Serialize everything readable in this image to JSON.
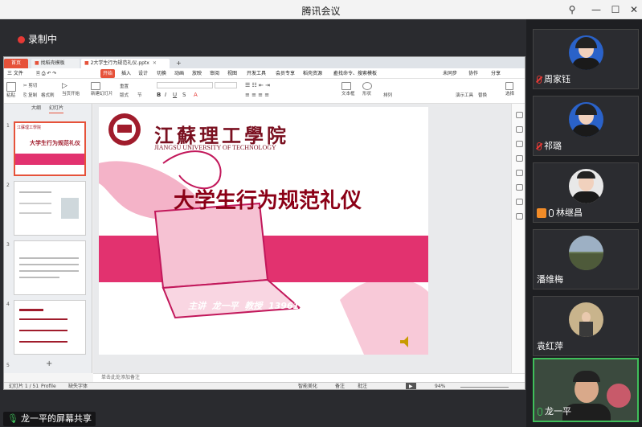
{
  "window": {
    "title": "腾讯会议"
  },
  "recording": {
    "label": "录制中"
  },
  "share_status": "龙一平的屏幕共享",
  "wps": {
    "tabs": [
      {
        "label": "首页"
      },
      {
        "label": "找稻壳模板"
      },
      {
        "label": "2大学生行为规范礼仪.pptx"
      }
    ],
    "menu": [
      "三 文件",
      "开始",
      "插入",
      "设计",
      "切换",
      "动画",
      "放映",
      "审阅",
      "视图",
      "开发工具",
      "会员专享",
      "稻壳资源"
    ],
    "menu_search": "查找命令、搜索模板",
    "menu_right": [
      "未同步",
      "协作",
      "分享"
    ],
    "toolbar_left": [
      "粘贴",
      "剪切",
      "复制",
      "格式刷",
      "当页开始",
      "新建幻灯片",
      "版式",
      "节",
      "重置"
    ],
    "toolbar_right": [
      "文本框",
      "形状",
      "排列",
      "演示工具",
      "替换",
      "选择"
    ],
    "left_tabs": [
      "大纲",
      "幻灯片"
    ],
    "slide_count": [
      "1",
      "2",
      "3",
      "4",
      "5"
    ],
    "notes_placeholder": "单击此处添加备注",
    "status": {
      "page": "幻灯片 1 / 51",
      "profile": "Profile",
      "font_missing": "缺失字体",
      "beautify": "智能美化",
      "notes": "备注",
      "comment": "批注",
      "zoom": "94%"
    },
    "slide": {
      "school_cn": "江蘇理工學院",
      "school_en": "JIANGSU UNIVERSITY OF TECHNOLOGY",
      "title": "大学生行为规范礼仪",
      "presenter": "主讲  龙一平  教授  13961122308"
    }
  },
  "participants": [
    {
      "name": "周家钰",
      "mic": "muted"
    },
    {
      "name": "祁璐",
      "mic": "muted"
    },
    {
      "name": "林继昌",
      "mic": "on"
    },
    {
      "name": "潘维梅",
      "mic": "none"
    },
    {
      "name": "袁红萍",
      "mic": "none"
    },
    {
      "name": "龙一平",
      "mic": "on"
    }
  ],
  "colors": {
    "accent": "#e6523a",
    "brand_pink": "#e2326f",
    "speaking": "#3fbf5a"
  }
}
